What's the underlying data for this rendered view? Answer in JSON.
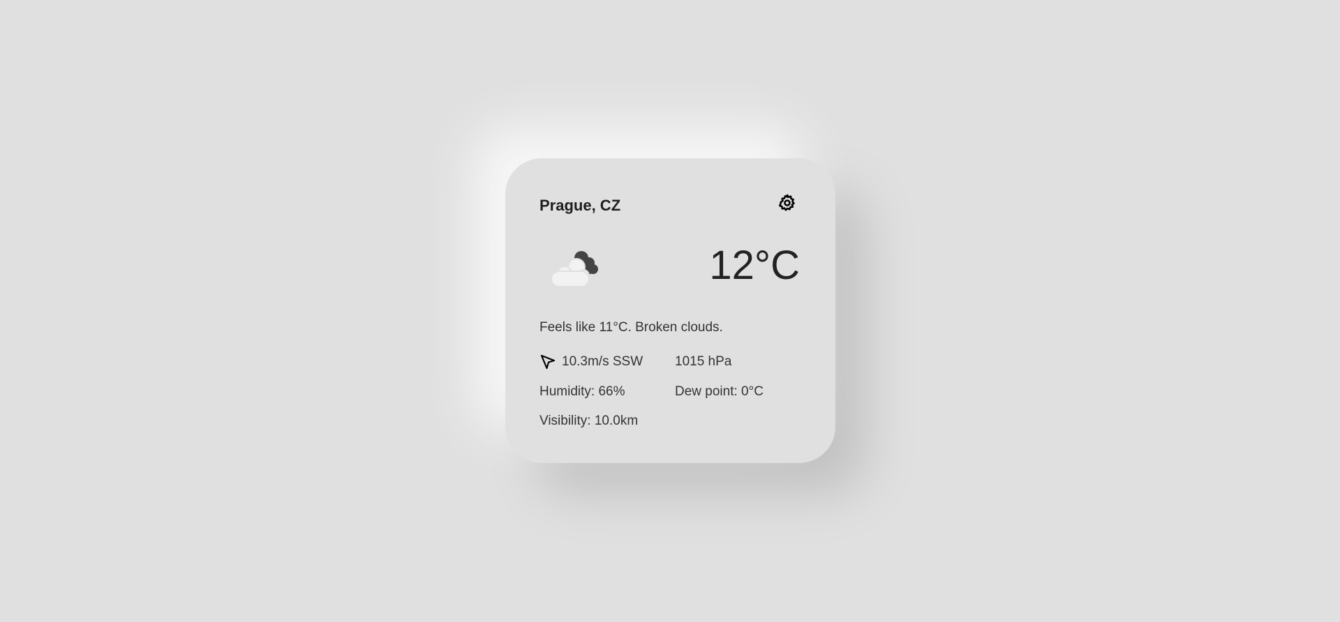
{
  "location": "Prague, CZ",
  "temperature": "12°C",
  "summary": "Feels like 11°C. Broken clouds.",
  "details": {
    "wind": "10.3m/s SSW",
    "pressure": "1015 hPa",
    "humidity": "Humidity: 66%",
    "dew_point": "Dew point: 0°C",
    "visibility": "Visibility: 10.0km"
  },
  "icons": {
    "settings": "gear-icon",
    "weather": "broken-clouds-icon",
    "wind": "navigation-arrow-icon"
  }
}
